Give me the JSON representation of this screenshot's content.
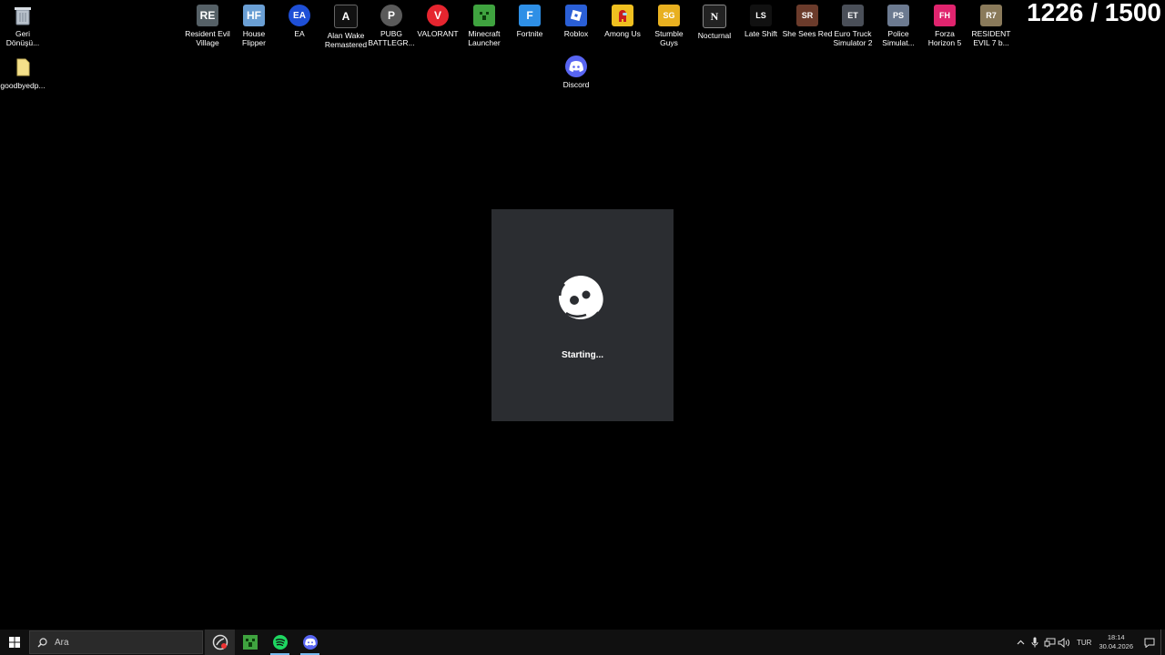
{
  "desktop": {
    "icons": [
      {
        "label": "Geri\nDönüşü...",
        "icon": "recycle-bin-icon",
        "color": "#9aa6b2",
        "glyph": "🗑"
      },
      {
        "label": "goodbyedp...",
        "icon": "folder-icon",
        "color": "#f4d97a",
        "glyph": ""
      },
      {
        "label": "Resident Evil\nVillage",
        "icon": "resident-evil-village-icon",
        "color": "#556066",
        "glyph": "RE"
      },
      {
        "label": "House\nFlipper",
        "icon": "house-flipper-icon",
        "color": "#6a9fd4",
        "glyph": "HF"
      },
      {
        "label": "EA",
        "icon": "ea-icon",
        "color": "#1e4fd6",
        "glyph": "EA"
      },
      {
        "label": "Alan Wake\nRemastered",
        "icon": "alan-wake-icon",
        "color": "#111111",
        "glyph": "A"
      },
      {
        "label": "PUBG\nBATTLEGR...",
        "icon": "pubg-icon",
        "color": "#5a5a5a",
        "glyph": "P"
      },
      {
        "label": "VALORANT",
        "icon": "valorant-icon",
        "color": "#e6252f",
        "glyph": "V"
      },
      {
        "label": "Minecraft\nLauncher",
        "icon": "minecraft-icon",
        "color": "#3fa33f",
        "glyph": "▦"
      },
      {
        "label": "Fortnite",
        "icon": "fortnite-icon",
        "color": "#2e8fe6",
        "glyph": "F"
      },
      {
        "label": "Roblox",
        "icon": "roblox-icon",
        "color": "#2a5fd6",
        "glyph": "◆"
      },
      {
        "label": "Among Us",
        "icon": "among-us-icon",
        "color": "#c81e1e",
        "glyph": "AU"
      },
      {
        "label": "Stumble\nGuys",
        "icon": "stumble-guys-icon",
        "color": "#e8b020",
        "glyph": "SG"
      },
      {
        "label": "Nocturnal",
        "icon": "nocturnal-icon",
        "color": "#222222",
        "glyph": "N"
      },
      {
        "label": "Late Shift",
        "icon": "late-shift-icon",
        "color": "#111111",
        "glyph": "LS"
      },
      {
        "label": "She Sees Red",
        "icon": "she-sees-red-icon",
        "color": "#6b3b2b",
        "glyph": "SR"
      },
      {
        "label": "Euro Truck\nSimulator 2",
        "icon": "euro-truck-icon",
        "color": "#4a4f58",
        "glyph": "ET"
      },
      {
        "label": "Police\nSimulat...",
        "icon": "police-simulator-icon",
        "color": "#6c7a90",
        "glyph": "PS"
      },
      {
        "label": "Forza\nHorizon 5",
        "icon": "forza-horizon-icon",
        "color": "#e0246e",
        "glyph": "FH"
      },
      {
        "label": "RESIDENT\nEVIL 7 b...",
        "icon": "resident-evil-7-icon",
        "color": "#8a7a5a",
        "glyph": "R7"
      },
      {
        "label": "Discord",
        "icon": "discord-icon",
        "color": "#5865f2",
        "glyph": ""
      }
    ]
  },
  "counter": {
    "text": "1226 / 1500"
  },
  "splash": {
    "status": "Starting...",
    "logo": "discord-logo-icon",
    "bg": "#2b2d31"
  },
  "taskbar": {
    "search_placeholder": "Ara",
    "apps": [
      {
        "name": "game-launcher-taskbar-icon",
        "active": true
      },
      {
        "name": "minecraft-taskbar-icon",
        "active": false
      },
      {
        "name": "spotify-taskbar-icon",
        "active": false
      },
      {
        "name": "discord-taskbar-icon",
        "active": false
      }
    ],
    "language": "TUR",
    "time": "18:14",
    "date": "30.04.2026"
  }
}
